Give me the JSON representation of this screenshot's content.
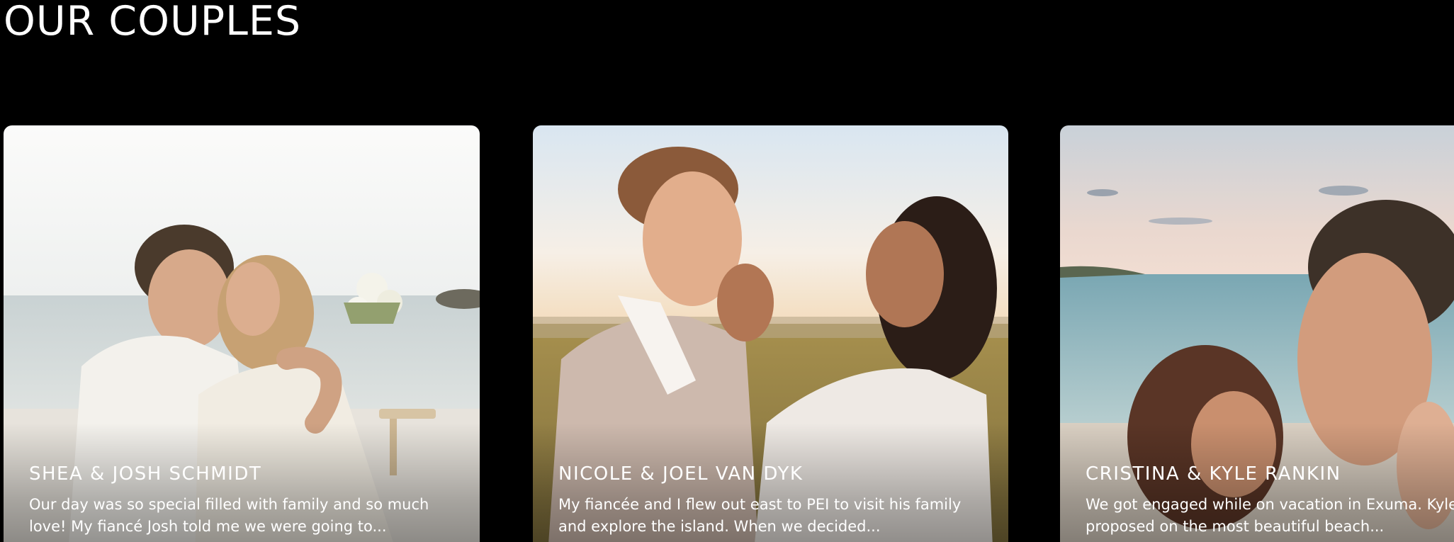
{
  "section": {
    "title": "OUR COUPLES"
  },
  "couples": [
    {
      "name": "SHEA & JOSH SCHMIDT",
      "excerpt_line1": "Our day was so special filled with family and so much",
      "excerpt_line2": "love! My fiancé Josh told me we were going to..."
    },
    {
      "name": "NICOLE & JOEL VAN DYK",
      "excerpt_line1": "My fiancée and I flew out east to PEI to visit his family",
      "excerpt_line2": "and explore the island. When we decided..."
    },
    {
      "name": "CRISTINA & KYLE RANKIN",
      "excerpt_line1": "We got engaged while on vacation in Exuma. Kyle",
      "excerpt_line2": "proposed on the most beautiful beach..."
    }
  ],
  "colors": {
    "background": "#000000",
    "text": "#ffffff"
  }
}
